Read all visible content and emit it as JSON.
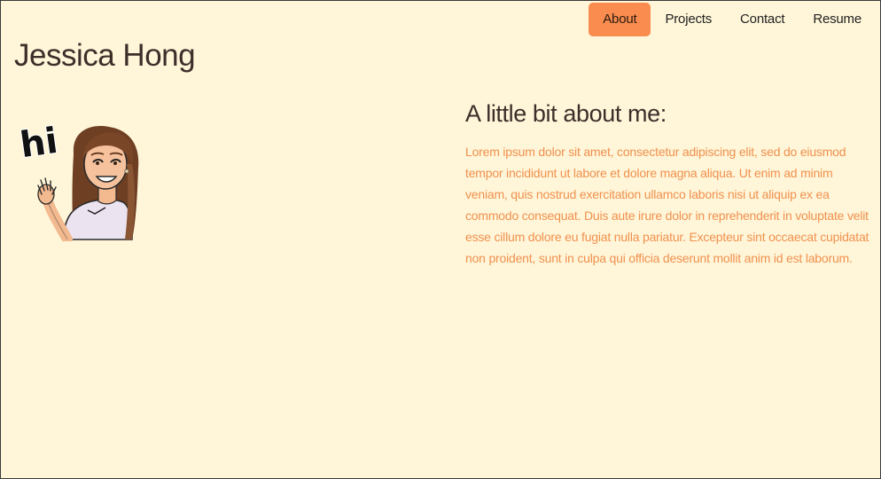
{
  "nav": {
    "items": [
      {
        "label": "About",
        "active": true
      },
      {
        "label": "Projects",
        "active": false
      },
      {
        "label": "Contact",
        "active": false
      },
      {
        "label": "Resume",
        "active": false
      }
    ]
  },
  "header": {
    "title": "Jessica Hong"
  },
  "avatar": {
    "greeting": "hi"
  },
  "about": {
    "heading": "A little bit about me:",
    "body": "Lorem ipsum dolor sit amet, consectetur adipiscing elit, sed do eiusmod tempor incididunt ut labore et dolore magna aliqua. Ut enim ad minim veniam, quis nostrud exercitation ullamco laboris nisi ut aliquip ex ea commodo consequat. Duis aute irure dolor in reprehenderit in voluptate velit esse cillum dolore eu fugiat nulla pariatur. Excepteur sint occaecat cupidatat non proident, sunt in culpa qui officia deserunt mollit anim id est laborum."
  },
  "colors": {
    "background": "#fff6d9",
    "accent": "#f98c4e",
    "body_text": "#f0904e",
    "heading_text": "#3d2e2a"
  }
}
